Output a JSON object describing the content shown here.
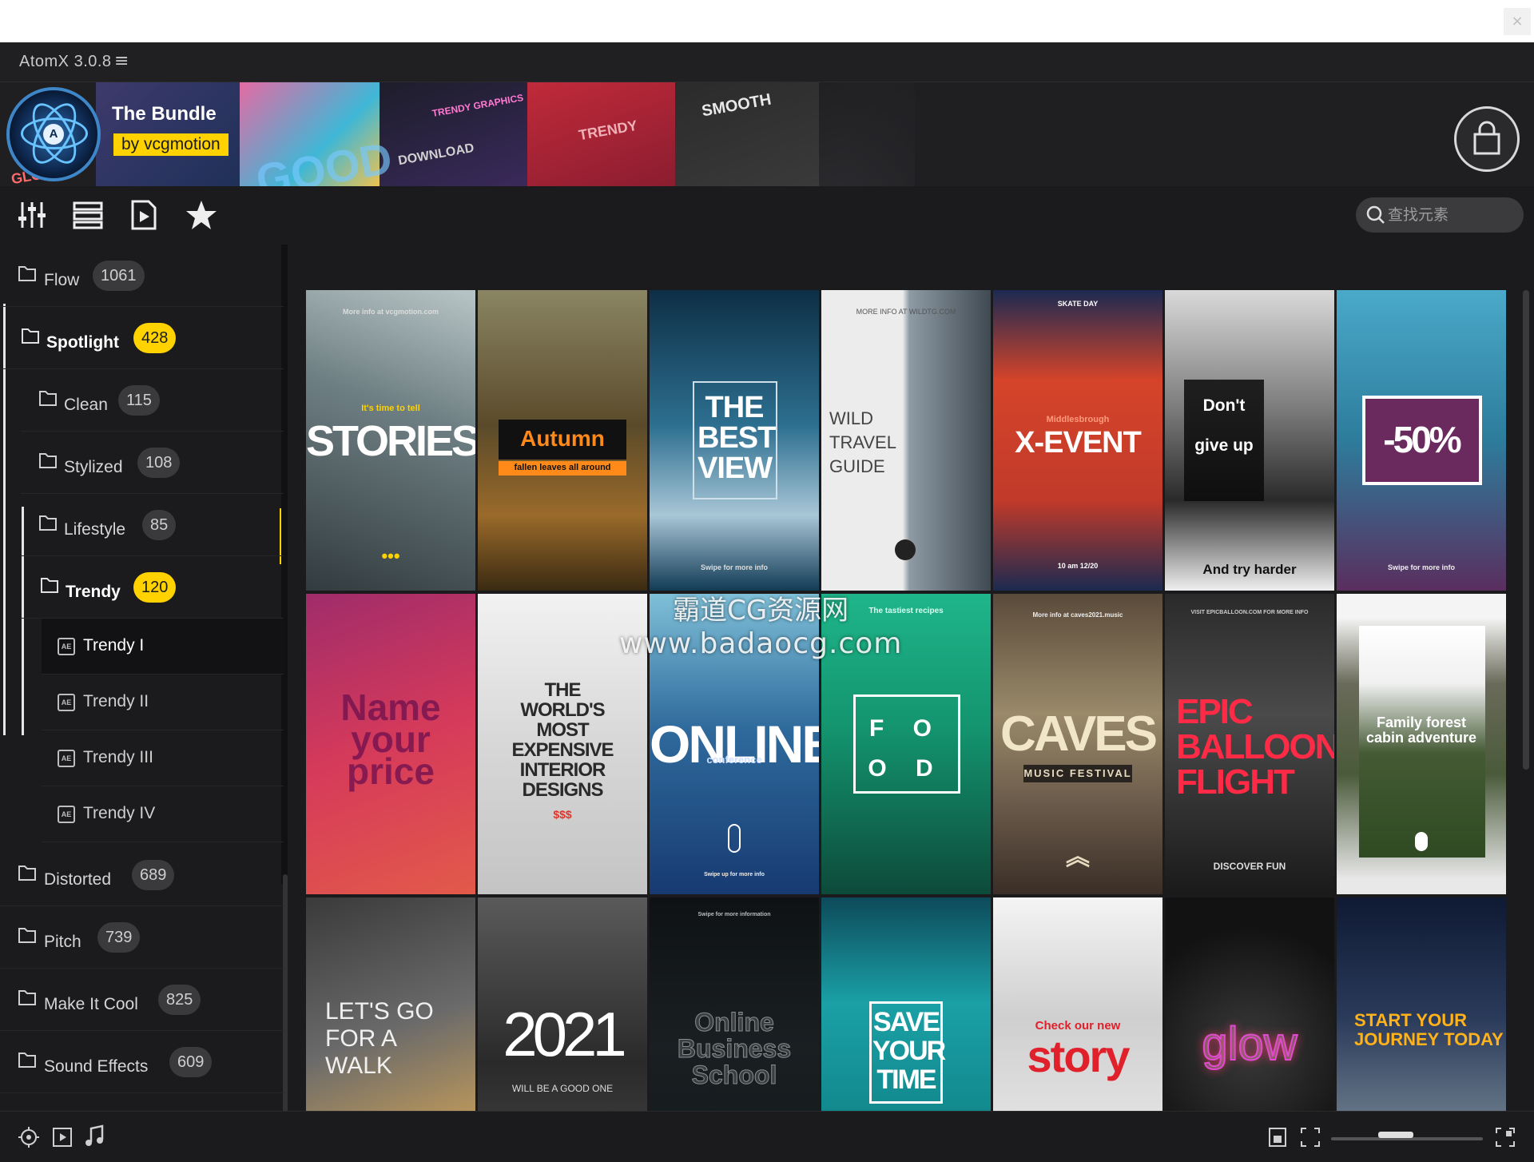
{
  "app": {
    "title": "AtomX 3.0.8",
    "menu_glyph": "≡",
    "close_glyph": "×"
  },
  "banner": {
    "title": "The Bundle",
    "byline": "by vcgmotion",
    "collage_texts": [
      "TRENDY GRAPHICS",
      "DOWNLOAD",
      "TRENDY",
      "SMOOTH",
      "GOOD",
      "GLO"
    ]
  },
  "toolbar": {
    "tools": [
      "sliders-icon",
      "list-icon",
      "video-file-icon",
      "star-icon"
    ]
  },
  "search": {
    "placeholder": "查找元素"
  },
  "sidebar": {
    "items": [
      {
        "label": "Flow",
        "count": "1061"
      },
      {
        "label": "Spotlight",
        "count": "428"
      },
      {
        "label": "Clean",
        "count": "115"
      },
      {
        "label": "Stylized",
        "count": "108"
      },
      {
        "label": "Lifestyle",
        "count": "85"
      },
      {
        "label": "Trendy",
        "count": "120"
      },
      {
        "label": "Distorted",
        "count": "689"
      },
      {
        "label": "Pitch",
        "count": "739"
      },
      {
        "label": "Make It Cool",
        "count": "825"
      },
      {
        "label": "Sound Effects",
        "count": "609"
      }
    ],
    "trendy_sub": [
      "Trendy I",
      "Trendy II",
      "Trendy III",
      "Trendy IV"
    ],
    "ae_badge": "AE"
  },
  "grid": {
    "cards": [
      {
        "main": "STORIES",
        "sub": "It's time to tell",
        "top": "More info at vcgmotion.com",
        "dots": "•••"
      },
      {
        "main": "Autumn",
        "sub": "fallen leaves all around",
        "top": ""
      },
      {
        "main": "THE BEST VIEW",
        "sub": "Swipe for more info",
        "top": ""
      },
      {
        "main": "WILD TRAVEL GUIDE",
        "sub": "",
        "top": "MORE INFO AT WILDTG.COM"
      },
      {
        "main": "X-EVENT",
        "sub": "Middlesbrough",
        "top": "SKATE DAY",
        "date": "10 am 12/20"
      },
      {
        "main": "Don't give up",
        "sub": "And try harder",
        "top": ""
      },
      {
        "main": "-50%",
        "sub": "Swipe for more info",
        "top": ""
      },
      {
        "main": "Name your price",
        "sub": "",
        "top": ""
      },
      {
        "main": "THE WORLD'S MOST EXPENSIVE INTERIOR DESIGNS",
        "sub": "$$$",
        "top": ""
      },
      {
        "main": "ONLINE",
        "sub": "conference",
        "top": "",
        "bottom": "Swipe up for more info"
      },
      {
        "main": "F O O D",
        "sub": "The tastiest recipes",
        "top": ""
      },
      {
        "main": "CAVES",
        "sub": "MUSIC FESTIVAL",
        "top": "More info at caves2021.music"
      },
      {
        "main": "EPIC BALLOON FLIGHT",
        "sub": "DISCOVER FUN",
        "top": "VISIT EPICBALLOON.COM FOR MORE INFO"
      },
      {
        "main": "Family forest cabin adventure",
        "sub": "",
        "top": ""
      },
      {
        "main": "LET'S GO FOR A WALK",
        "sub": "",
        "top": ""
      },
      {
        "main": "2021",
        "sub": "WILL BE A GOOD ONE",
        "top": ""
      },
      {
        "main": "Online Business School",
        "sub": "",
        "top": "Swipe for more information"
      },
      {
        "main": "SAVE YOUR TIME",
        "sub": "",
        "top": ""
      },
      {
        "main": "story",
        "sub": "Check our new",
        "top": ""
      },
      {
        "main": "glow",
        "sub": "",
        "top": ""
      },
      {
        "main": "START YOUR JOURNEY TODAY",
        "sub": "",
        "top": ""
      }
    ]
  },
  "watermark": {
    "line1": "霸道CG资源网",
    "line2": "www.badaocg.com"
  },
  "bottombar": {
    "left_icons": [
      "crosshair-icon",
      "play-box-icon",
      "music-note-icon"
    ],
    "right_icons": [
      "lock-icon",
      "fit-icon",
      "expand-icon"
    ]
  },
  "colors": {
    "accent": "#ffd200",
    "background": "#1b1b1d",
    "badge": "#3a3a3c"
  }
}
